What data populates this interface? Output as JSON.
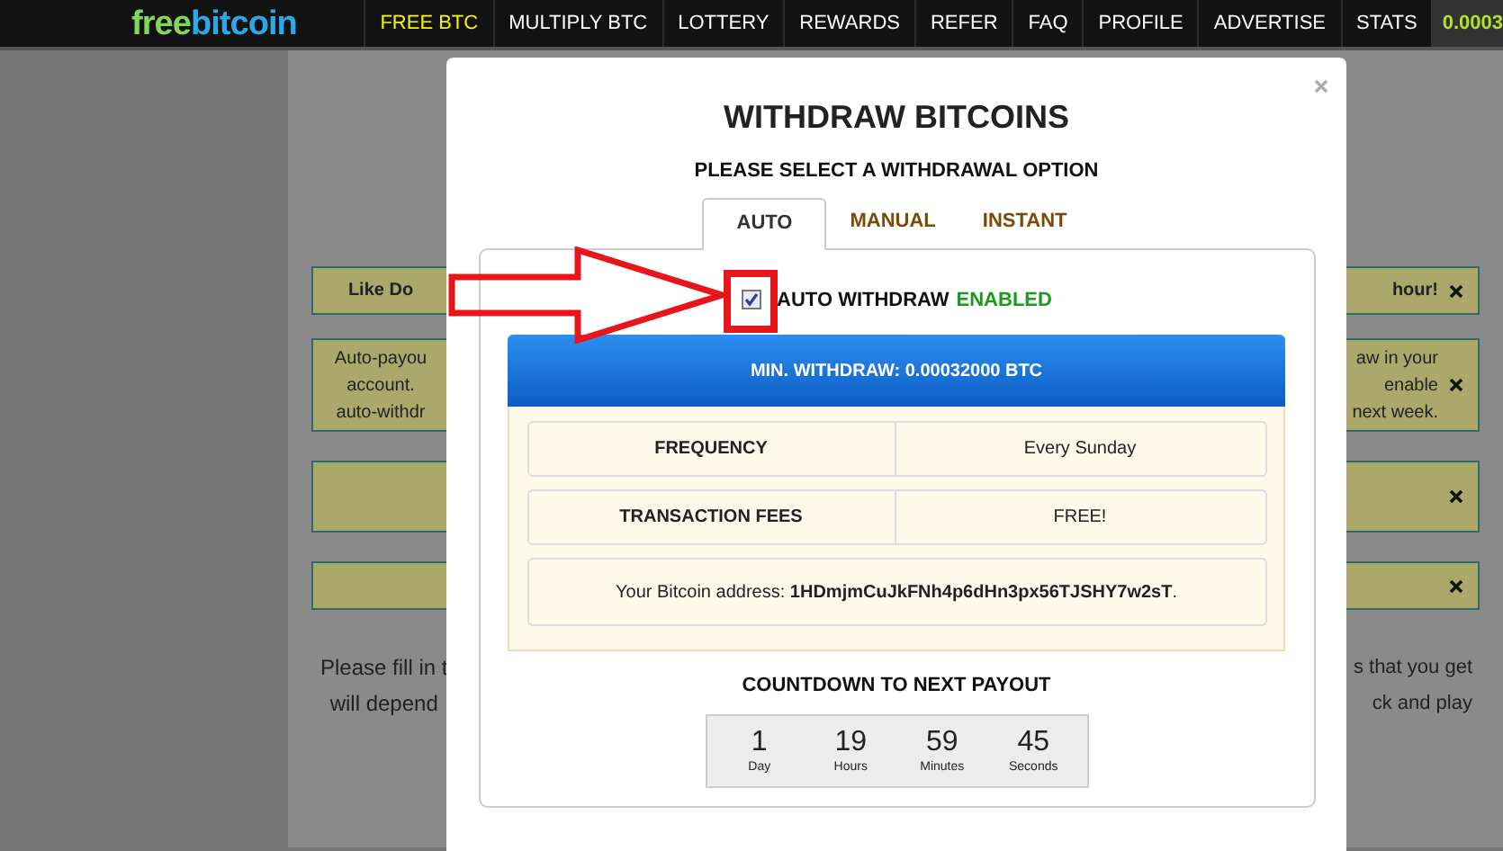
{
  "nav": {
    "logo": {
      "first": "free",
      "second": "bitcoin"
    },
    "items": [
      {
        "label": "FREE BTC",
        "selected": true
      },
      {
        "label": "MULTIPLY BTC",
        "selected": false
      },
      {
        "label": "LOTTERY",
        "selected": false
      },
      {
        "label": "REWARDS",
        "selected": false
      },
      {
        "label": "REFER",
        "selected": false
      },
      {
        "label": "FAQ",
        "selected": false
      },
      {
        "label": "PROFILE",
        "selected": false
      },
      {
        "label": "ADVERTISE",
        "selected": false
      },
      {
        "label": "STATS",
        "selected": false
      }
    ],
    "balance": "0.0003"
  },
  "background": {
    "notices": [
      {
        "closable": true,
        "left": [
          "Like Do"
        ],
        "right": [
          "hour!"
        ]
      },
      {
        "closable": true,
        "left": [
          "Auto-payou",
          "account.",
          "auto-withdr"
        ],
        "right": [
          "aw in your",
          "enable",
          "next week."
        ]
      },
      {
        "closable": true
      },
      {
        "closable": true
      }
    ],
    "paragraph_left": [
      "Please fill in t",
      "will depend"
    ],
    "paragraph_right": [
      "s that you get",
      "ck and play"
    ]
  },
  "modal": {
    "title": "WITHDRAW BITCOINS",
    "subtitle": "PLEASE SELECT A WITHDRAWAL OPTION",
    "tabs": [
      {
        "label": "AUTO",
        "selected": true
      },
      {
        "label": "MANUAL",
        "selected": false
      },
      {
        "label": "INSTANT",
        "selected": false
      }
    ],
    "auto_withdraw": {
      "checked": true,
      "label": "AUTO WITHDRAW",
      "status": "ENABLED"
    },
    "min_withdraw": "MIN. WITHDRAW: 0.00032000 BTC",
    "rows": [
      {
        "label": "FREQUENCY",
        "value": "Every Sunday"
      },
      {
        "label": "TRANSACTION FEES",
        "value": "FREE!"
      }
    ],
    "address": "Your Bitcoin address: **1HDmjmCuJkFNh4p6dHn3px56TJSHY7w2sT**.",
    "countdown": {
      "title": "COUNTDOWN TO NEXT PAYOUT",
      "units": [
        {
          "value": "1",
          "unit": "Day"
        },
        {
          "value": "19",
          "unit": "Hours"
        },
        {
          "value": "59",
          "unit": "Minutes"
        },
        {
          "value": "45",
          "unit": "Seconds"
        }
      ]
    }
  }
}
